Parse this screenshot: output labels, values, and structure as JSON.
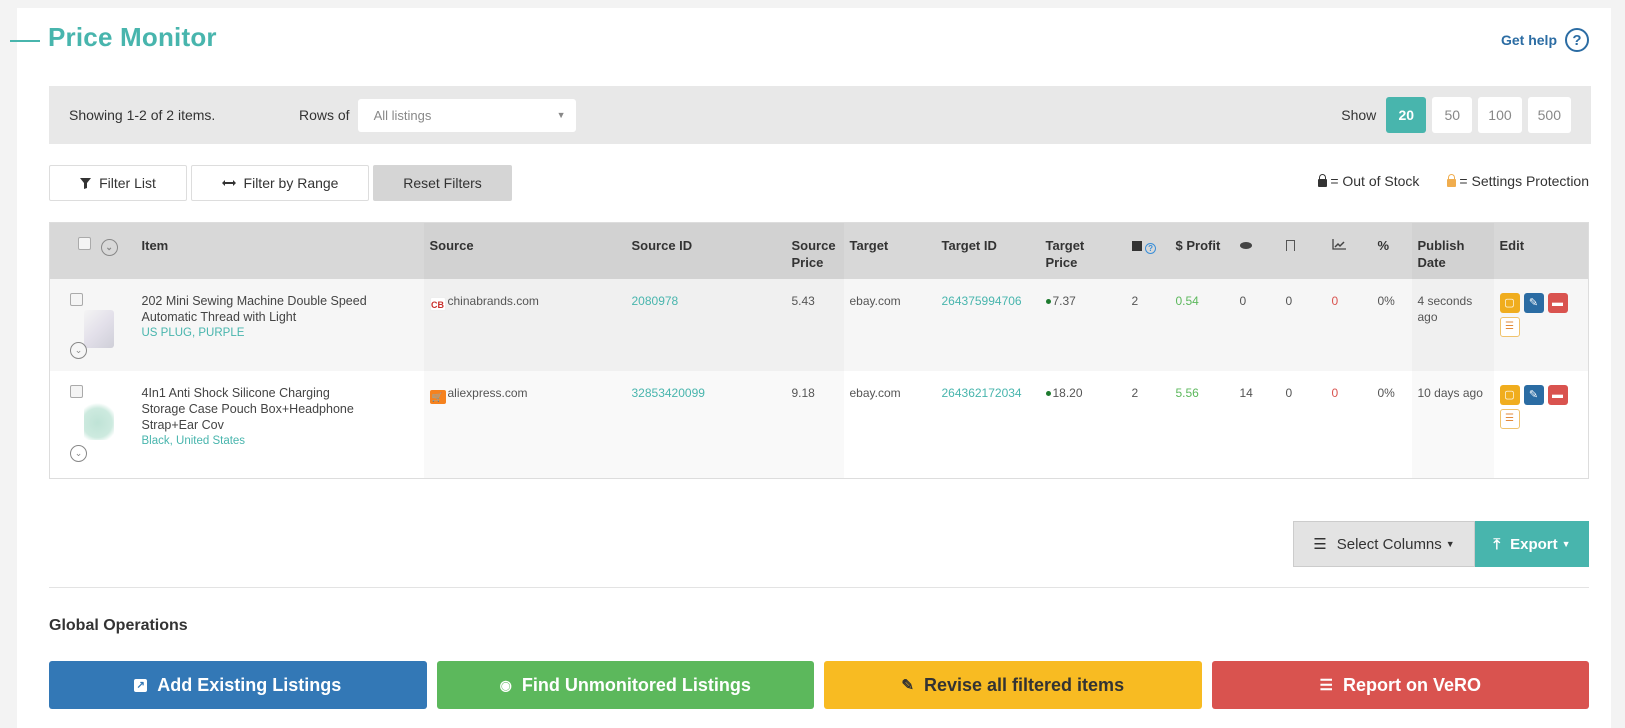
{
  "header": {
    "title": "Price Monitor",
    "help_label": "Get help",
    "help_icon": "?"
  },
  "toolbar": {
    "showing_text": "Showing 1-2 of 2 items.",
    "rows_of_label": "Rows of",
    "rows_of_value": "All listings",
    "show_label": "Show",
    "page_sizes": [
      "20",
      "50",
      "100",
      "500"
    ],
    "active_page_size": "20"
  },
  "filters": {
    "filter_list": "Filter List",
    "filter_by_range": "Filter by Range",
    "reset_filters": "Reset Filters"
  },
  "legend": {
    "out_of_stock": "= Out of Stock",
    "settings_protection": "= Settings Protection",
    "out_of_stock_color": "#333333",
    "settings_protection_color": "#f0ad4e"
  },
  "table": {
    "columns": {
      "item": "Item",
      "source": "Source",
      "source_id": "Source ID",
      "source_price_1": "Source",
      "source_price_2": "Price",
      "target": "Target",
      "target_id": "Target ID",
      "target_price_1": "Target",
      "target_price_2": "Price",
      "quantity_icon": "box-icon",
      "profit": "$ Profit",
      "views_icon": "eye-icon",
      "watchers_icon": "bookmark-icon",
      "sales_icon": "chart-icon",
      "percent": "%",
      "publish_date_1": "Publish",
      "publish_date_2": "Date",
      "edit": "Edit"
    },
    "rows": [
      {
        "title_line1": "202 Mini Sewing Machine Double Speed",
        "title_line2": "Automatic Thread with Light",
        "title_line3": "",
        "variation": "US PLUG, PURPLE",
        "source": "chinabrands.com",
        "source_id": "2080978",
        "source_price": "5.43",
        "target": "ebay.com",
        "target_id": "264375994706",
        "target_price": "7.37",
        "quantity": "2",
        "profit": "0.54",
        "views": "0",
        "watchers": "0",
        "sales": "0",
        "percent": "0%",
        "publish_line1": "4 seconds",
        "publish_line2": "ago"
      },
      {
        "title_line1": "4In1 Anti Shock Silicone Charging",
        "title_line2": "Storage Case Pouch Box+Headphone",
        "title_line3": "Strap+Ear Cov",
        "variation": "Black, United States",
        "source": "aliexpress.com",
        "source_id": "32853420099",
        "source_price": "9.18",
        "target": "ebay.com",
        "target_id": "264362172034",
        "target_price": "18.20",
        "quantity": "2",
        "profit": "5.56",
        "views": "14",
        "watchers": "0",
        "sales": "0",
        "percent": "0%",
        "publish_line1": "10 days ago",
        "publish_line2": ""
      }
    ]
  },
  "actions": {
    "select_columns": "Select Columns",
    "export": "Export"
  },
  "global_operations": {
    "title": "Global Operations",
    "add_existing": "Add Existing Listings",
    "find_unmonitored": "Find Unmonitored Listings",
    "revise_filtered": "Revise all filtered items",
    "report_vero": "Report on VeRO"
  },
  "colors": {
    "accent": "#48b5ad",
    "primary": "#3378b6",
    "success": "#5cb85c",
    "warning": "#f8bb22",
    "danger": "#d9534f"
  }
}
